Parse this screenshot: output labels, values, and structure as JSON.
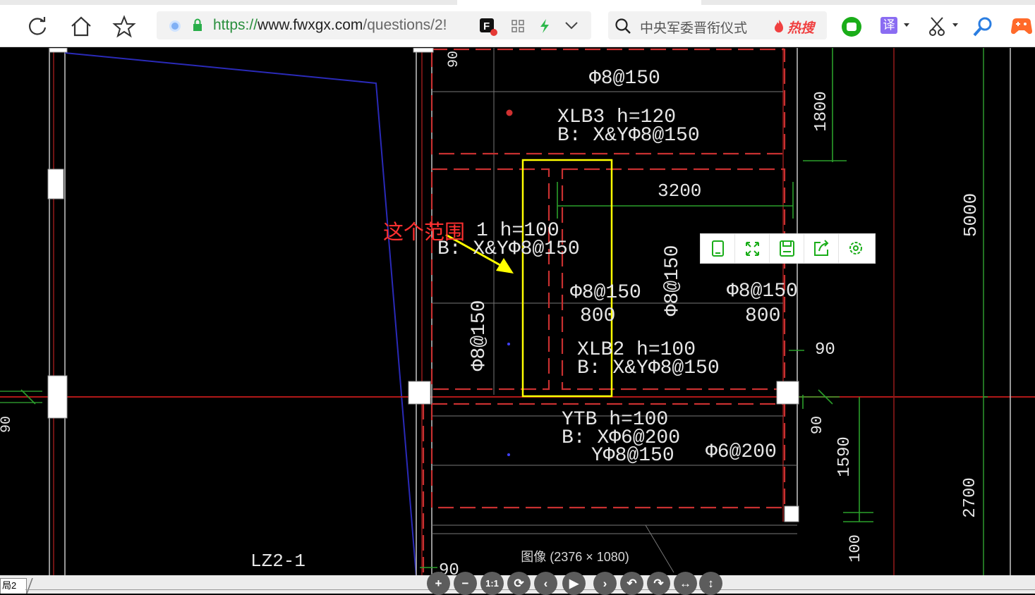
{
  "browser": {
    "url_protocol": "https://",
    "url_host": "www.fwxgx.com",
    "url_path": "/questions/2!",
    "search_placeholder": "中央军委晋衔仪式",
    "hot_search_label": "热搜",
    "translate_label": "译"
  },
  "cad": {
    "annotation": "这个范围",
    "labels": {
      "top_rebar": "Φ8@150",
      "xlb3_line1": "XLB3 h=120",
      "xlb3_line2": "B: X&YΦ8@150",
      "dim_1800": "1800",
      "dim_3200": "3200",
      "dim_5000": "5000",
      "xlb1_line1": "1 h=100",
      "xlb1_line2": "B: X&YΦ8@150",
      "rebar_vertical_mid": "Φ8@150",
      "rebar_vertical_left": "Φ8@150",
      "rebar_mid_top": "Φ8@150",
      "rebar_mid_len": "800",
      "rebar_right_top": "Φ8@150",
      "rebar_right_len": "800",
      "xlb2_line1": "XLB2 h=100",
      "xlb2_line2": "B: X&YΦ8@150",
      "dim_90_right": "90",
      "ytb_line1": "YTB h=100",
      "ytb_line2": "B: XΦ6@200",
      "ytb_line3": "YΦ8@150",
      "rebar_bottom_right": "Φ6@200",
      "dim_90_vertical": "90",
      "dim_1590": "1590",
      "dim_2700": "2700",
      "dim_100": "100",
      "dim_90_bottom": "90",
      "dim_90_left": "90",
      "column_label": "LZ2-1",
      "dim_top_clipped": "90"
    }
  },
  "image_viewer": {
    "info": "图像 (2376 × 1080)",
    "toolbar_icons": [
      "tablet-icon",
      "fullscreen-icon",
      "save-icon",
      "share-icon",
      "settings-icon"
    ],
    "controls": [
      "+",
      "−",
      "1:1",
      "⟳",
      "‹",
      "▶",
      "›",
      "↶",
      "↷",
      "↔",
      "↕"
    ]
  },
  "sheet_tab": "局2",
  "colors": {
    "cad_background": "#000000",
    "annotation_red": "#ff3030",
    "highlight_yellow": "#ffff00",
    "cad_text": "#e6e6e6",
    "accent_green": "#1aad19"
  }
}
